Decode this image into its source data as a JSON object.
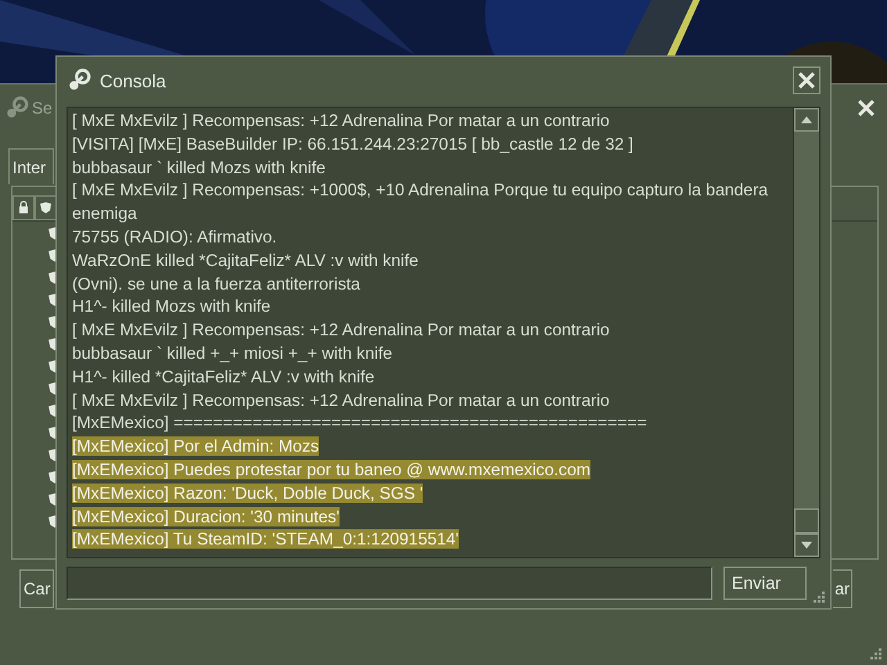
{
  "back_window": {
    "title": "Se",
    "tab": "Inter",
    "buttons": [
      "Car",
      "ar"
    ]
  },
  "console": {
    "title": "Consola",
    "lines": [
      {
        "text": "[ MxE MxEvilz ] Recompensas: +12 Adrenalina Por matar a un contrario",
        "highlighted": false
      },
      {
        "text": "[VISITA] [MxE] BaseBuilder IP: 66.151.244.23:27015 [ bb_castle 12 de 32 ]",
        "highlighted": false
      },
      {
        "text": "bubbasaur ` killed Mozs with knife",
        "highlighted": false
      },
      {
        "text": "[ MxE MxEvilz ] Recompensas: +1000$, +10 Adrenalina Porque tu equipo capturo la bandera enemiga",
        "highlighted": false
      },
      {
        "text": "75755 (RADIO): Afirmativo.",
        "highlighted": false
      },
      {
        "text": "WaRzOnE killed *CajitaFeliz* ALV :v with knife",
        "highlighted": false
      },
      {
        "text": "(Ovni). se une a la fuerza antiterrorista",
        "highlighted": false
      },
      {
        "text": "H1^- killed Mozs with knife",
        "highlighted": false
      },
      {
        "text": "[ MxE MxEvilz ] Recompensas: +12 Adrenalina Por matar a un contrario",
        "highlighted": false
      },
      {
        "text": "bubbasaur ` killed +_+ miosi +_+ with knife",
        "highlighted": false
      },
      {
        "text": "H1^- killed *CajitaFeliz* ALV :v with knife",
        "highlighted": false
      },
      {
        "text": "[ MxE MxEvilz ] Recompensas: +12 Adrenalina Por matar a un contrario",
        "highlighted": false
      },
      {
        "text": "[MxEMexico] ================================================",
        "highlighted": false
      },
      {
        "text": "[MxEMexico] Por el Admin: Mozs",
        "highlighted": true
      },
      {
        "text": "[MxEMexico] Puedes protestar por tu baneo @ www.mxemexico.com",
        "highlighted": true
      },
      {
        "text": "[MxEMexico] Razon: 'Duck, Doble Duck, SGS '",
        "highlighted": true
      },
      {
        "text": "[MxEMexico] Duracion: '30 minutes'",
        "highlighted": true
      },
      {
        "text": "[MxEMexico] Tu SteamID: 'STEAM_0:1:120915514'",
        "highlighted": true
      }
    ],
    "send_button": "Enviar"
  }
}
